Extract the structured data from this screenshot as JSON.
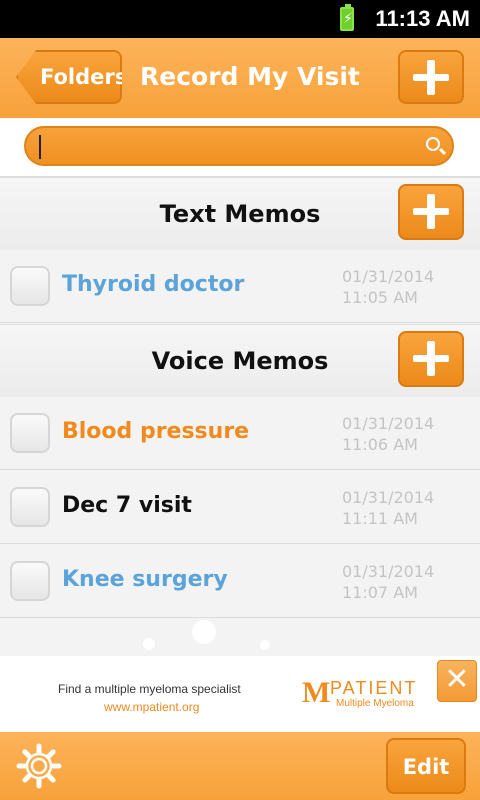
{
  "status_bar": {
    "time": "11:13 AM",
    "battery_icon": "battery-charging-icon"
  },
  "header": {
    "back_label": "Folders",
    "title": "Record My Visit",
    "add_icon": "plus-icon"
  },
  "search": {
    "value": "",
    "placeholder": "",
    "icon": "search-icon"
  },
  "sections": {
    "text_memos": {
      "label": "Text Memos",
      "items": [
        {
          "title": "Thyroid doctor",
          "date": "01/31/2014",
          "time": "11:05 AM",
          "color": "#5ba3d9"
        }
      ]
    },
    "voice_memos": {
      "label": "Voice Memos",
      "items": [
        {
          "title": "Blood pressure",
          "date": "01/31/2014",
          "time": "11:06 AM",
          "color": "#f08a1c"
        },
        {
          "title": "Dec 7 visit",
          "date": "01/31/2014",
          "time": "11:11 AM",
          "color": "#111111"
        },
        {
          "title": "Knee surgery",
          "date": "01/31/2014",
          "time": "11:07 AM",
          "color": "#5ba3d9"
        }
      ]
    }
  },
  "ad": {
    "line1": "Find a multiple myeloma specialist",
    "line2": "www.mpatient.org",
    "logo_letter": "M",
    "brand": "PATIENT",
    "sub": "Multiple Myeloma",
    "close_label": "✕"
  },
  "footer": {
    "settings_icon": "gear-icon",
    "edit_label": "Edit"
  },
  "colors": {
    "accent": "#f7a23a",
    "accent_dark": "#ec8a1a",
    "link_blue": "#5ba3d9"
  }
}
